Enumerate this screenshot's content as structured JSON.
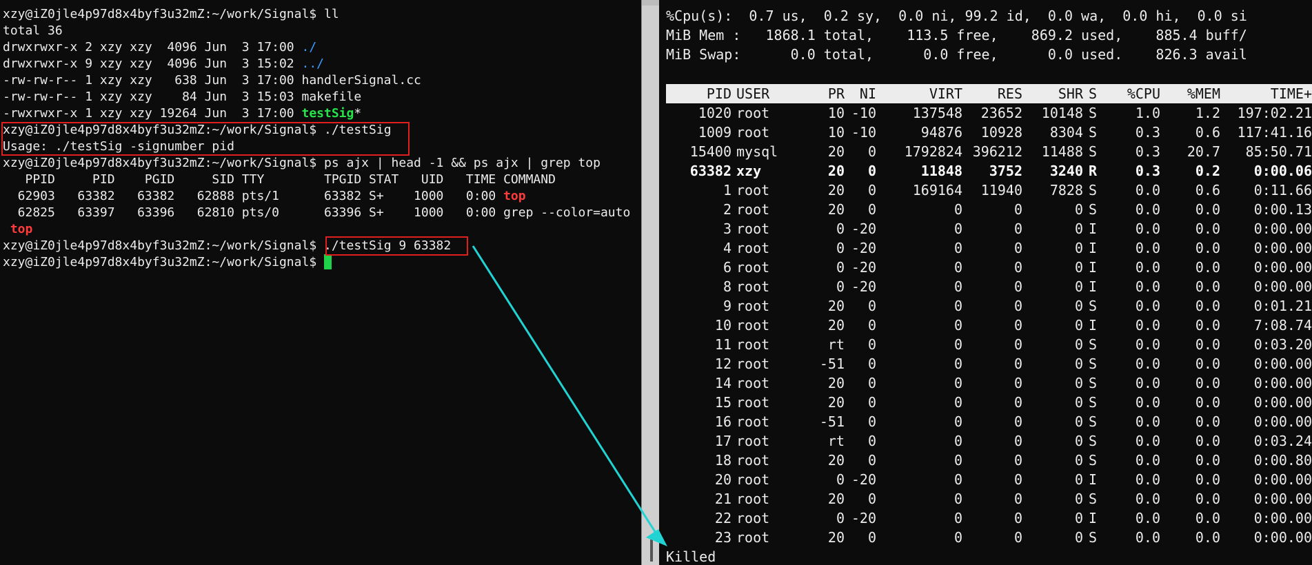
{
  "left_terminal": {
    "prompt": "xzy@iZ0jle4p97d8x4byf3u32mZ:~/work/Signal$",
    "lines": [
      {
        "prompt": "xzy@iZ0jle4p97d8x4byf3u32mZ:~/work/Signal$",
        "cmd": " ll"
      },
      {
        "text": "total 36"
      },
      {
        "text": "drwxrwxr-x 2 xzy xzy  4096 Jun  3 17:00 ",
        "colored": "./",
        "color": "blue"
      },
      {
        "text": "drwxrwxr-x 9 xzy xzy  4096 Jun  3 15:02 ",
        "colored": "../",
        "color": "blue"
      },
      {
        "text": "-rw-rw-r-- 1 xzy xzy   638 Jun  3 17:00 handlerSignal.cc"
      },
      {
        "text": "-rw-rw-r-- 1 xzy xzy    84 Jun  3 15:03 makefile"
      },
      {
        "text": "-rwxrwxr-x 1 xzy xzy 19264 Jun  3 17:00 ",
        "colored": "testSig",
        "color": "green",
        "suffix": "*"
      },
      {
        "prompt": "xzy@iZ0jle4p97d8x4byf3u32mZ:~/work/Signal$",
        "cmd": " ./testSig"
      },
      {
        "text": "Usage: ./testSig -signumber pid"
      },
      {
        "prompt": "xzy@iZ0jle4p97d8x4byf3u32mZ:~/work/Signal$",
        "cmd": " ps ajx | head -1 && ps ajx | grep top"
      },
      {
        "text": "   PPID     PID    PGID     SID TTY        TPGID STAT   UID   TIME COMMAND"
      },
      {
        "text": "  62903   63382   63382   62888 pts/1      63382 S+    1000   0:00 ",
        "colored": "top",
        "color": "red"
      },
      {
        "text": "  62825   63397   63396   62810 pts/0      63396 S+    1000   0:00 grep --color=auto"
      },
      {
        "text": " ",
        "colored": "top",
        "color": "red"
      },
      {
        "prompt": "xzy@iZ0jle4p97d8x4byf3u32mZ:~/work/Signal$",
        "cmd": " ./testSig 9 63382"
      },
      {
        "prompt": "xzy@iZ0jle4p97d8x4byf3u32mZ:~/work/Signal$",
        "cmd": " ",
        "cursor": true
      }
    ]
  },
  "top": {
    "summary": [
      "%Cpu(s):  0.7 us,  0.2 sy,  0.0 ni, 99.2 id,  0.0 wa,  0.0 hi,  0.0 si",
      "MiB Mem :   1868.1 total,    113.5 free,    869.2 used,    885.4 buff/",
      "MiB Swap:      0.0 total,      0.0 free,      0.0 used.    826.3 avail"
    ],
    "columns": [
      "PID",
      "USER",
      "PR",
      "NI",
      "VIRT",
      "RES",
      "SHR",
      "S",
      "%CPU",
      "%MEM",
      "TIME+"
    ],
    "rows": [
      [
        "1020",
        "root",
        "10",
        "-10",
        "137548",
        "23652",
        "10148",
        "S",
        "1.0",
        "1.2",
        "197:02.21"
      ],
      [
        "1009",
        "root",
        "10",
        "-10",
        "94876",
        "10928",
        "8304",
        "S",
        "0.3",
        "0.6",
        "117:41.16"
      ],
      [
        "15400",
        "mysql",
        "20",
        "0",
        "1792824",
        "396212",
        "11488",
        "S",
        "0.3",
        "20.7",
        "85:50.71"
      ],
      [
        "63382",
        "xzy",
        "20",
        "0",
        "11848",
        "3752",
        "3240",
        "R",
        "0.3",
        "0.2",
        "0:00.06"
      ],
      [
        "1",
        "root",
        "20",
        "0",
        "169164",
        "11940",
        "7828",
        "S",
        "0.0",
        "0.6",
        "0:11.66"
      ],
      [
        "2",
        "root",
        "20",
        "0",
        "0",
        "0",
        "0",
        "S",
        "0.0",
        "0.0",
        "0:00.13"
      ],
      [
        "3",
        "root",
        "0",
        "-20",
        "0",
        "0",
        "0",
        "I",
        "0.0",
        "0.0",
        "0:00.00"
      ],
      [
        "4",
        "root",
        "0",
        "-20",
        "0",
        "0",
        "0",
        "I",
        "0.0",
        "0.0",
        "0:00.00"
      ],
      [
        "6",
        "root",
        "0",
        "-20",
        "0",
        "0",
        "0",
        "I",
        "0.0",
        "0.0",
        "0:00.00"
      ],
      [
        "8",
        "root",
        "0",
        "-20",
        "0",
        "0",
        "0",
        "I",
        "0.0",
        "0.0",
        "0:00.00"
      ],
      [
        "9",
        "root",
        "20",
        "0",
        "0",
        "0",
        "0",
        "S",
        "0.0",
        "0.0",
        "0:01.21"
      ],
      [
        "10",
        "root",
        "20",
        "0",
        "0",
        "0",
        "0",
        "I",
        "0.0",
        "0.0",
        "7:08.74"
      ],
      [
        "11",
        "root",
        "rt",
        "0",
        "0",
        "0",
        "0",
        "S",
        "0.0",
        "0.0",
        "0:03.20"
      ],
      [
        "12",
        "root",
        "-51",
        "0",
        "0",
        "0",
        "0",
        "S",
        "0.0",
        "0.0",
        "0:00.00"
      ],
      [
        "14",
        "root",
        "20",
        "0",
        "0",
        "0",
        "0",
        "S",
        "0.0",
        "0.0",
        "0:00.00"
      ],
      [
        "15",
        "root",
        "20",
        "0",
        "0",
        "0",
        "0",
        "S",
        "0.0",
        "0.0",
        "0:00.00"
      ],
      [
        "16",
        "root",
        "-51",
        "0",
        "0",
        "0",
        "0",
        "S",
        "0.0",
        "0.0",
        "0:00.00"
      ],
      [
        "17",
        "root",
        "rt",
        "0",
        "0",
        "0",
        "0",
        "S",
        "0.0",
        "0.0",
        "0:03.24"
      ],
      [
        "18",
        "root",
        "20",
        "0",
        "0",
        "0",
        "0",
        "S",
        "0.0",
        "0.0",
        "0:00.80"
      ],
      [
        "20",
        "root",
        "0",
        "-20",
        "0",
        "0",
        "0",
        "I",
        "0.0",
        "0.0",
        "0:00.00"
      ],
      [
        "21",
        "root",
        "20",
        "0",
        "0",
        "0",
        "0",
        "S",
        "0.0",
        "0.0",
        "0:00.00"
      ],
      [
        "22",
        "root",
        "0",
        "-20",
        "0",
        "0",
        "0",
        "I",
        "0.0",
        "0.0",
        "0:00.00"
      ],
      [
        "23",
        "root",
        "20",
        "0",
        "0",
        "0",
        "0",
        "S",
        "0.0",
        "0.0",
        "0:00.00"
      ]
    ],
    "highlight_pid": "63382",
    "killed_text": "Killed"
  },
  "colors": {
    "background": "#0c0c0c",
    "text": "#ececec",
    "highlight_box": "#e21f1f",
    "arrow": "#22d3d3",
    "dir_blue": "#3a9bff",
    "exec_green": "#27e34a",
    "match_red": "#ff3b3b",
    "cursor_green": "#1ed24a"
  }
}
